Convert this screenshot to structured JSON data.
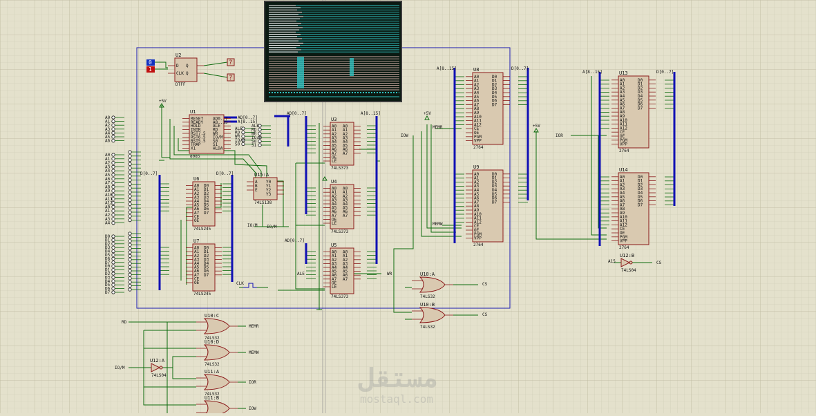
{
  "colors": {
    "grid_background": "#e4e1cc",
    "grid_line": "#c9c6ad",
    "wire": "#0d6a0d",
    "bus": "#1010b4",
    "chip_body": "#d9c9b0",
    "chip_border": "#8b1a1a",
    "logic_probe_high": "#c01010",
    "logic_probe_low": "#1030c0",
    "analyzer_screen": "#0b1a12",
    "analyzer_trace": "#30c0c0"
  },
  "logic_probes": {
    "low": "0",
    "high": "1"
  },
  "question_marks": [
    "?",
    "?"
  ],
  "components": [
    {
      "ref": "U2",
      "part": "DTFF"
    },
    {
      "ref": "U1",
      "part": "8085"
    },
    {
      "ref": "U3",
      "part": "74LS373"
    },
    {
      "ref": "U4",
      "part": "74LS373"
    },
    {
      "ref": "U5",
      "part": "74LS373"
    },
    {
      "ref": "U6",
      "part": "74LS245"
    },
    {
      "ref": "U7",
      "part": "74LS245"
    },
    {
      "ref": "U8",
      "part": "2764"
    },
    {
      "ref": "U9",
      "part": "2764"
    },
    {
      "ref": "U13",
      "part": "2764"
    },
    {
      "ref": "U14",
      "part": "2764"
    },
    {
      "ref": "U15:A",
      "part": "74LS138"
    },
    {
      "ref": "U10:A",
      "part": "74LS32"
    },
    {
      "ref": "U10:B",
      "part": "74LS32"
    },
    {
      "ref": "U10:C",
      "part": "74LS32"
    },
    {
      "ref": "U10:D",
      "part": "74LS32"
    },
    {
      "ref": "U11:A",
      "part": "74LS32"
    },
    {
      "ref": "U11:B",
      "part": "74LS32"
    },
    {
      "ref": "U12:A",
      "part": "74LS04"
    },
    {
      "ref": "U12:B",
      "part": "74LS04"
    }
  ],
  "pin_labels": {
    "address": [
      "A0",
      "A1",
      "A2",
      "A3",
      "A4",
      "A5",
      "A6",
      "A7",
      "A8",
      "A9",
      "A10",
      "A11",
      "A12"
    ],
    "data": [
      "D0",
      "D1",
      "D2",
      "D3",
      "D4",
      "D5",
      "D6",
      "D7"
    ],
    "u1": [
      "RESET",
      "READY",
      "HOLD",
      "INTR",
      "RST7.5",
      "RST6.5",
      "RST5.5",
      "TRAP",
      "X1",
      "SID",
      "CLK"
    ],
    "u1_out": [
      "AD0..7",
      "A8..15",
      "ALE",
      "RD",
      "WR",
      "IO/M",
      "S0",
      "S1",
      "HLDA",
      "SOD"
    ],
    "mem_ctrl": [
      "CE",
      "OE",
      "PGM",
      "VPP"
    ],
    "latch_ctrl": [
      "LE",
      "OE"
    ]
  },
  "net_labels": [
    "AD[0..7]",
    "A[8..15]",
    "D[0..7]",
    "ALE",
    "RD",
    "WR",
    "IO/M",
    "CLK",
    "MEMR",
    "MEMW",
    "IOR",
    "IOW",
    "A15",
    "CS",
    "+5V"
  ],
  "watermark": {
    "brand": "مستقل",
    "url": "mostaql.com"
  }
}
